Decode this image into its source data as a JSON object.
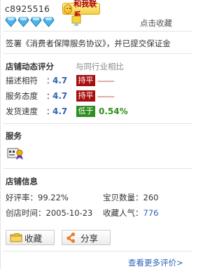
{
  "header": {
    "seller_name": "c8925516",
    "contact_label": "和我联系",
    "collect_label": "点击收藏",
    "diamond_count": 4,
    "diamond_color": "#4fb3e8"
  },
  "agreement_text": "签署《消费者保障服务协议》，并已提交保证金",
  "ratings": {
    "title": "店铺动态评分",
    "compare_title": "与同行业相比",
    "rows": [
      {
        "label": "描述相符",
        "colon": "：",
        "score": "4.7",
        "badge": "持平",
        "trend": "--------",
        "kind": "even"
      },
      {
        "label": "服务态度",
        "colon": "：",
        "score": "4.7",
        "badge": "持平",
        "trend": "--------",
        "kind": "even"
      },
      {
        "label": "发货速度",
        "colon": "：",
        "score": "4.7",
        "badge": "低于",
        "trend": "0.54%",
        "kind": "low"
      }
    ],
    "colors": {
      "score": "#2e63b6",
      "even": "#a80f0f",
      "low": "#2f8e1f"
    }
  },
  "service": {
    "title": "服务",
    "icon": "service-badge-icon"
  },
  "shop_info": {
    "title": "店铺信息",
    "positive_rate_label": "好评率：",
    "positive_rate_value": "99.22%",
    "item_count_label": "宝贝数量：",
    "item_count_value": "260",
    "created_label": "创店时间：",
    "created_value": "2005-10-23",
    "popularity_label": "收藏人气：",
    "popularity_value": "776"
  },
  "buttons": {
    "favorite_label": "收藏",
    "share_label": "分享"
  },
  "more_reviews_label": "查看更多评价>"
}
